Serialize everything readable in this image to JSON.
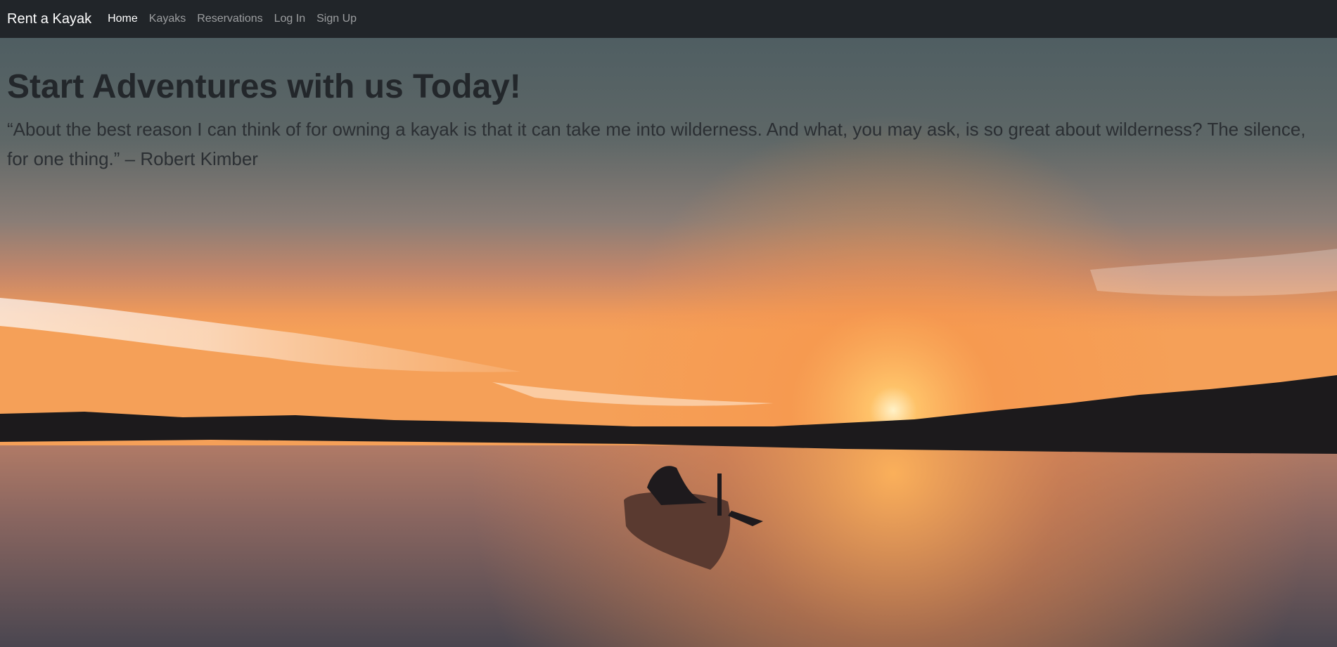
{
  "navbar": {
    "brand": "Rent a Kayak",
    "links": [
      {
        "label": "Home",
        "active": true
      },
      {
        "label": "Kayaks",
        "active": false
      },
      {
        "label": "Reservations",
        "active": false
      },
      {
        "label": "Log In",
        "active": false
      },
      {
        "label": "Sign Up",
        "active": false
      }
    ]
  },
  "hero": {
    "title": "Start Adventures with us Today!",
    "quote": "“About the best reason I can think of for owning a kayak is that it can take me into wilderness. And what, you may ask, is so great about wilderness? The silence, for one thing.” – Robert Kimber"
  },
  "colors": {
    "navbar_bg": "#212529",
    "nav_link": "#9a9da0",
    "nav_link_active": "#ffffff",
    "hero_text": "#23272b"
  }
}
